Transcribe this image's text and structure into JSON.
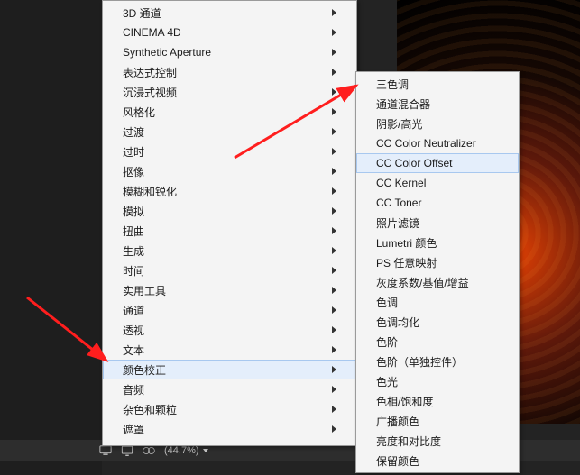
{
  "menu_a": {
    "items": [
      {
        "label": "3D 通道",
        "sub": true
      },
      {
        "label": "CINEMA 4D",
        "sub": true
      },
      {
        "label": "Synthetic Aperture",
        "sub": true
      },
      {
        "label": "表达式控制",
        "sub": true
      },
      {
        "label": "沉浸式视频",
        "sub": true
      },
      {
        "label": "风格化",
        "sub": true
      },
      {
        "label": "过渡",
        "sub": true
      },
      {
        "label": "过时",
        "sub": true
      },
      {
        "label": "抠像",
        "sub": true
      },
      {
        "label": "模糊和锐化",
        "sub": true
      },
      {
        "label": "模拟",
        "sub": true
      },
      {
        "label": "扭曲",
        "sub": true
      },
      {
        "label": "生成",
        "sub": true
      },
      {
        "label": "时间",
        "sub": true
      },
      {
        "label": "实用工具",
        "sub": true
      },
      {
        "label": "通道",
        "sub": true
      },
      {
        "label": "透视",
        "sub": true
      },
      {
        "label": "文本",
        "sub": true
      },
      {
        "label": "颜色校正",
        "sub": true,
        "hl": true
      },
      {
        "label": "音频",
        "sub": true
      },
      {
        "label": "杂色和颗粒",
        "sub": true
      },
      {
        "label": "遮罩",
        "sub": true
      }
    ]
  },
  "menu_b": {
    "items": [
      {
        "label": "三色调"
      },
      {
        "label": "通道混合器"
      },
      {
        "label": "阴影/高光"
      },
      {
        "label": "CC Color Neutralizer"
      },
      {
        "label": "CC Color Offset",
        "hl": true
      },
      {
        "label": "CC Kernel"
      },
      {
        "label": "CC Toner"
      },
      {
        "label": "照片滤镜"
      },
      {
        "label": "Lumetri 颜色"
      },
      {
        "label": "PS 任意映射"
      },
      {
        "label": "灰度系数/基值/增益"
      },
      {
        "label": "色调"
      },
      {
        "label": "色调均化"
      },
      {
        "label": "色阶"
      },
      {
        "label": "色阶（单独控件）"
      },
      {
        "label": "色光"
      },
      {
        "label": "色相/饱和度"
      },
      {
        "label": "广播颜色"
      },
      {
        "label": "亮度和对比度"
      },
      {
        "label": "保留颜色"
      }
    ]
  },
  "status_bar": {
    "zoom": "(44.7%)"
  }
}
